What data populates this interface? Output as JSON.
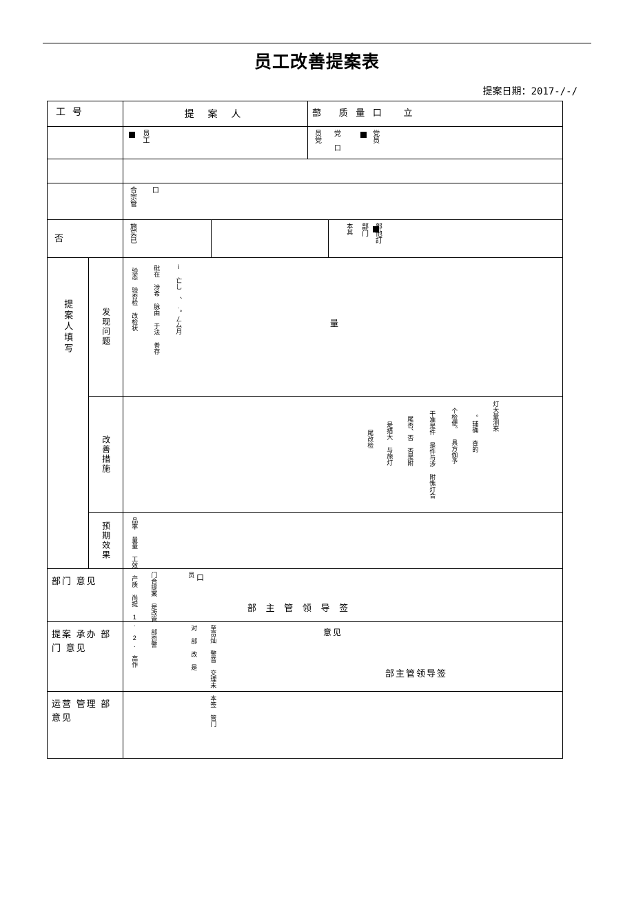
{
  "document": {
    "title": "员工改善提案表",
    "date_label": "提案日期：",
    "date_value": "2017-/-/"
  },
  "header_row": {
    "employee_no_label": "工 号",
    "proposer_label": "提 案 人",
    "dept_label": "蔀",
    "quality_label": "质 量 口",
    "extra_label": "立"
  },
  "row2": {
    "left_mark": "■",
    "employee": "员工",
    "party_member_label": "员党",
    "party_box": "党 口",
    "party_member": "党员"
  },
  "row4": {
    "scope_label": "合宗管",
    "scope_box": "口"
  },
  "row5": {
    "no_label": "否",
    "impl_label": "施实已",
    "this_dept_label": "本其",
    "dept_mark": "■",
    "dept_label": "部门",
    "sign_label": "部他訂"
  },
  "section_proposer": {
    "label": "提案人填写"
  },
  "block_problem": {
    "label": "发现问题",
    "col1": "验态 验否检 改检状",
    "col2": "砒在 涉希 脉由 于法 善存",
    "col3": "ì 亡乚 、.。ㄥ厶月",
    "center_text": "量"
  },
  "block_measure": {
    "label": "改善措施",
    "col1": "尾改检",
    "col2": "是措大 与施灯",
    "col3": "尾否、否 否是附",
    "col4": "干准是件 是件与涉 附憔灯合",
    "col5": "个检便。 具方伽予",
    "col6": "。辅确 查的",
    "col7": "灯大量测来"
  },
  "block_effect": {
    "label": "预期效果",
    "lines": "品率 量量 工效 产质 尚提 1. 2. 高作"
  },
  "row_dept_opinion": {
    "label": "部门 意见",
    "col1": "门合提案 是改管 部否警",
    "col2": "员",
    "box": "口",
    "signature": "部 主 管 领 导 签"
  },
  "row_handler": {
    "label": "提案 承办 部门 意见",
    "col1": "对 部 改 是",
    "col2": "至员灿 警音 交理未 本签 管门",
    "opinion_label": "意见",
    "signature": "部主管领导签"
  },
  "row_operation": {
    "label": "运营 管理 部意见"
  }
}
